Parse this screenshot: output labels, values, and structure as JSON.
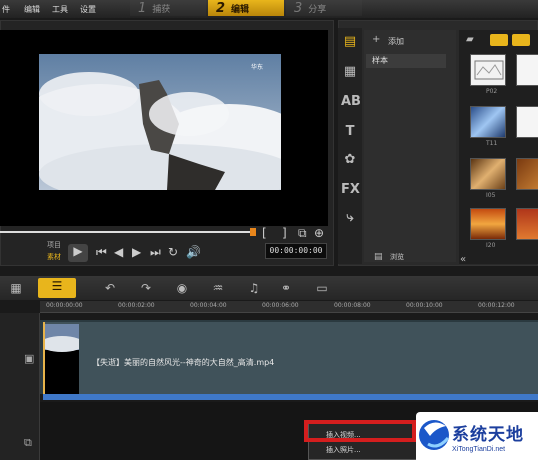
{
  "menu": {
    "items": [
      "件",
      "编辑",
      "工具",
      "设置"
    ]
  },
  "steps": [
    {
      "num": "1",
      "label": "捕获"
    },
    {
      "num": "2",
      "label": "编辑"
    },
    {
      "num": "3",
      "label": "分享"
    }
  ],
  "preview": {
    "video_watermark": "华东",
    "project_label": "项目",
    "clip_label": "素材",
    "timecode": "00:00:00:00"
  },
  "library": {
    "add_label": "添加",
    "sample_label": "样本",
    "browse_label": "浏览"
  },
  "thumbs": [
    {
      "label": "P02"
    },
    {
      "label": ""
    },
    {
      "label": "T11"
    },
    {
      "label": ""
    },
    {
      "label": "I05"
    },
    {
      "label": ""
    },
    {
      "label": "I20"
    },
    {
      "label": ""
    }
  ],
  "ruler": {
    "ticks": [
      "00:00:00:00",
      "00:00:02:00",
      "00:00:04:00",
      "00:00:06:00",
      "00:00:08:00",
      "00:00:10:00",
      "00:00:12:00"
    ]
  },
  "clip": {
    "name": "【失逝】美丽的自然风光--神奇的大自然_高清.mp4"
  },
  "context_menu": {
    "items": [
      "插入视频...",
      "插入照片..."
    ]
  },
  "watermark": {
    "title": "系统天地",
    "url": "XiTongTianDi.net"
  },
  "colors": {
    "accent": "#e8b51c",
    "highlight": "#d41e1e",
    "clip_bar": "#3f78c8"
  }
}
